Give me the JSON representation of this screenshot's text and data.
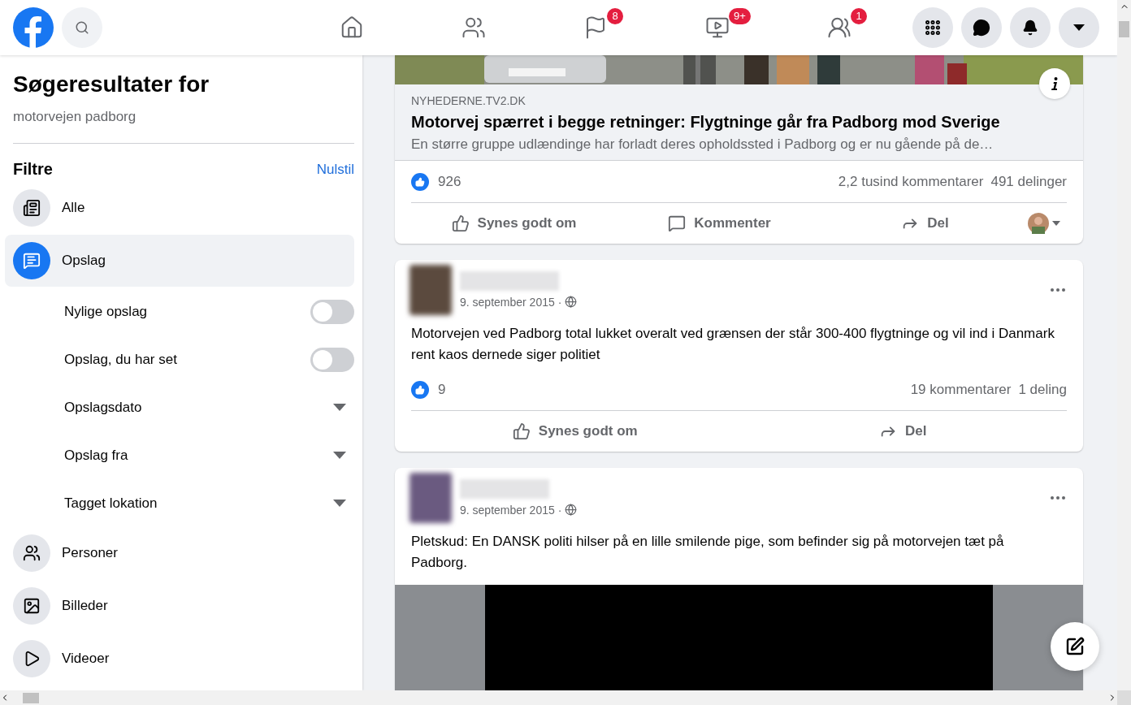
{
  "nav": {
    "tabs": [
      {
        "kind": "home"
      },
      {
        "kind": "friends"
      },
      {
        "kind": "pages",
        "badge": "8"
      },
      {
        "kind": "watch",
        "badge": "9+"
      },
      {
        "kind": "groups",
        "badge": "1"
      }
    ]
  },
  "sidebar": {
    "title": "Søgeresultater for",
    "query": "motorvejen padborg",
    "filters_label": "Filtre",
    "reset": "Nulstil",
    "items": [
      {
        "kind": "category",
        "label": "Alle",
        "selected": false
      },
      {
        "kind": "category",
        "label": "Opslag",
        "selected": true
      },
      {
        "kind": "toggle",
        "label": "Nylige opslag",
        "on": false
      },
      {
        "kind": "toggle",
        "label": "Opslag, du har set",
        "on": false
      },
      {
        "kind": "dropdown",
        "label": "Opslagsdato"
      },
      {
        "kind": "dropdown",
        "label": "Opslag fra"
      },
      {
        "kind": "dropdown",
        "label": "Tagget lokation"
      },
      {
        "kind": "category",
        "label": "Personer",
        "selected": false
      },
      {
        "kind": "category",
        "label": "Billeder",
        "selected": false
      },
      {
        "kind": "category",
        "label": "Videoer",
        "selected": false
      }
    ]
  },
  "posts": [
    {
      "kind": "link",
      "link": {
        "domain": "NYHEDERNE.TV2.DK",
        "title": "Motorvej spærret i begge retninger: Flygtninge går fra Padborg mod Sverige",
        "description": "En større gruppe udlændinge har forladt deres opholdssted i Padborg og er nu gående på de…"
      },
      "likes": "926",
      "comments": "2,2 tusind kommentarer",
      "shares": "491 delinger",
      "actions": [
        {
          "kind": "like",
          "label": "Synes godt om"
        },
        {
          "kind": "comment",
          "label": "Kommenter"
        },
        {
          "kind": "share",
          "label": "Del"
        }
      ]
    },
    {
      "kind": "text",
      "date": "9. september 2015 ·",
      "text": "Motorvejen ved Padborg total lukket overalt ved grænsen der står 300-400 flygtninge og vil ind i Danmark rent kaos dernede siger politiet",
      "likes": "9",
      "comments": "19 kommentarer",
      "shares": "1 deling",
      "actions": [
        {
          "kind": "like",
          "label": "Synes godt om"
        },
        {
          "kind": "share",
          "label": "Del"
        }
      ]
    },
    {
      "kind": "video",
      "date": "9. september 2015 ·",
      "text": "Pletskud: En DANSK politi hilser på en lille smilende pige, som befinder sig på motorvejen tæt på Padborg."
    }
  ]
}
